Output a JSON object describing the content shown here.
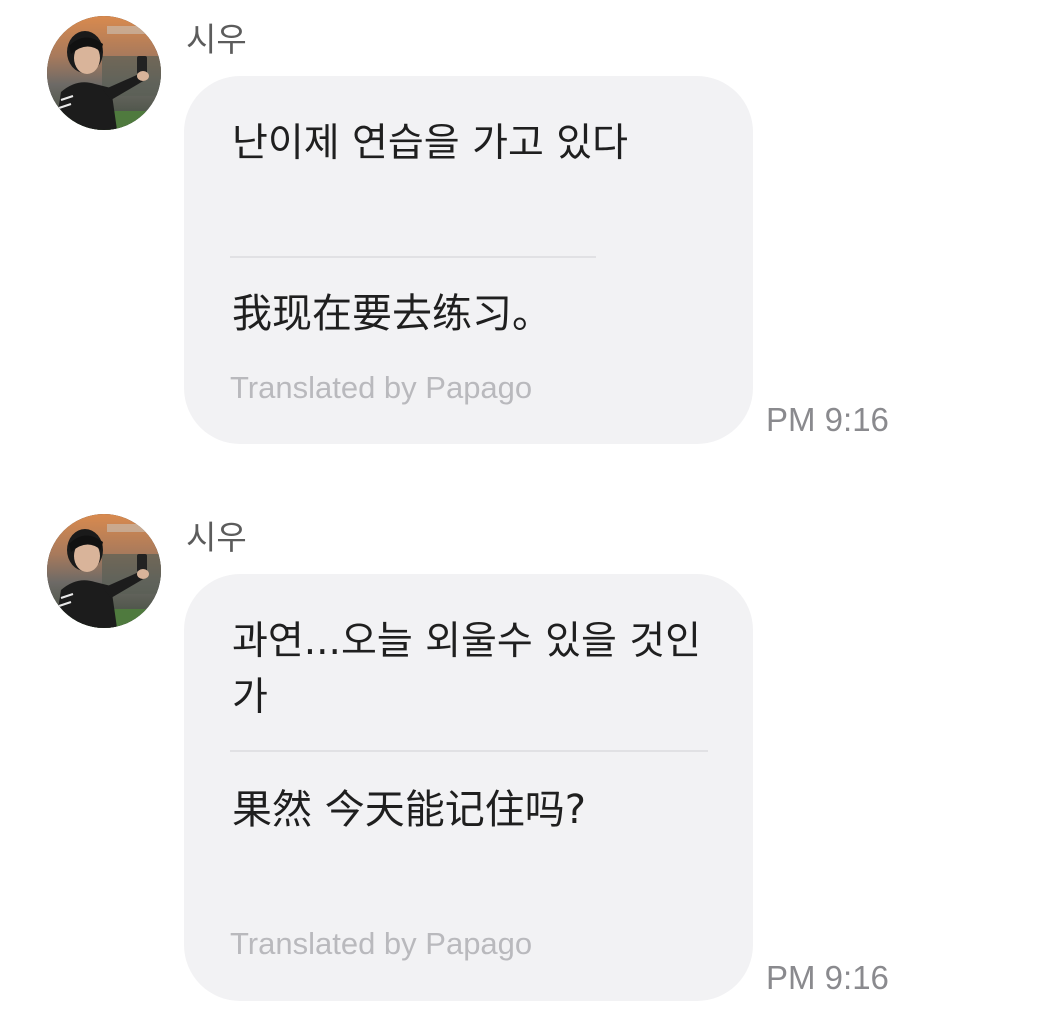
{
  "messages": [
    {
      "sender": "시우",
      "original_text": " 난이제 연습을 가고 있다",
      "translated_text": "我现在要去练习。",
      "translation_provider": "Translated by Papago",
      "time": "PM 9:16"
    },
    {
      "sender": "시우",
      "original_text": "과연...오늘 외울수 있을 것인가",
      "translated_text": "果然        今天能记住吗?",
      "translation_provider": "Translated by Papago",
      "time": "PM 9:16"
    }
  ],
  "colors": {
    "bubble_bg": "#f2f2f4",
    "sender_text": "#5c5c5c",
    "provider_text": "#b9b9bd",
    "time_text": "#8a8a8e",
    "divider": "#e1e1e4"
  }
}
